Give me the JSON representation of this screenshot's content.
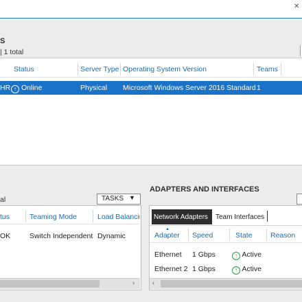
{
  "servers": {
    "title": "S",
    "subtitle": "| 1 total",
    "columns": [
      "Status",
      "Server Type",
      "Operating System Version",
      "Teams"
    ],
    "row": {
      "name": "HR",
      "status": "Online",
      "type": "Physical",
      "os": "Microsoft Windows Server 2016 Standard",
      "teams": "1"
    }
  },
  "teams": {
    "subtitle": "al",
    "tasks_label": "TASKS",
    "columns": [
      "tus",
      "Teaming Mode",
      "Load Balancin"
    ],
    "row": {
      "status": "OK",
      "mode": "Switch Independent",
      "lb": "Dynamic"
    }
  },
  "adapters": {
    "title": "ADAPTERS AND INTERFACES",
    "tabs": [
      "Network Adapters",
      "Team Interfaces"
    ],
    "columns": [
      "Adapter",
      "Speed",
      "State",
      "Reason"
    ],
    "rows": [
      {
        "adapter": "Ethernet",
        "speed": "1 Gbps",
        "state": "Active"
      },
      {
        "adapter": "Ethernet 2",
        "speed": "1 Gbps",
        "state": "Active"
      }
    ]
  }
}
